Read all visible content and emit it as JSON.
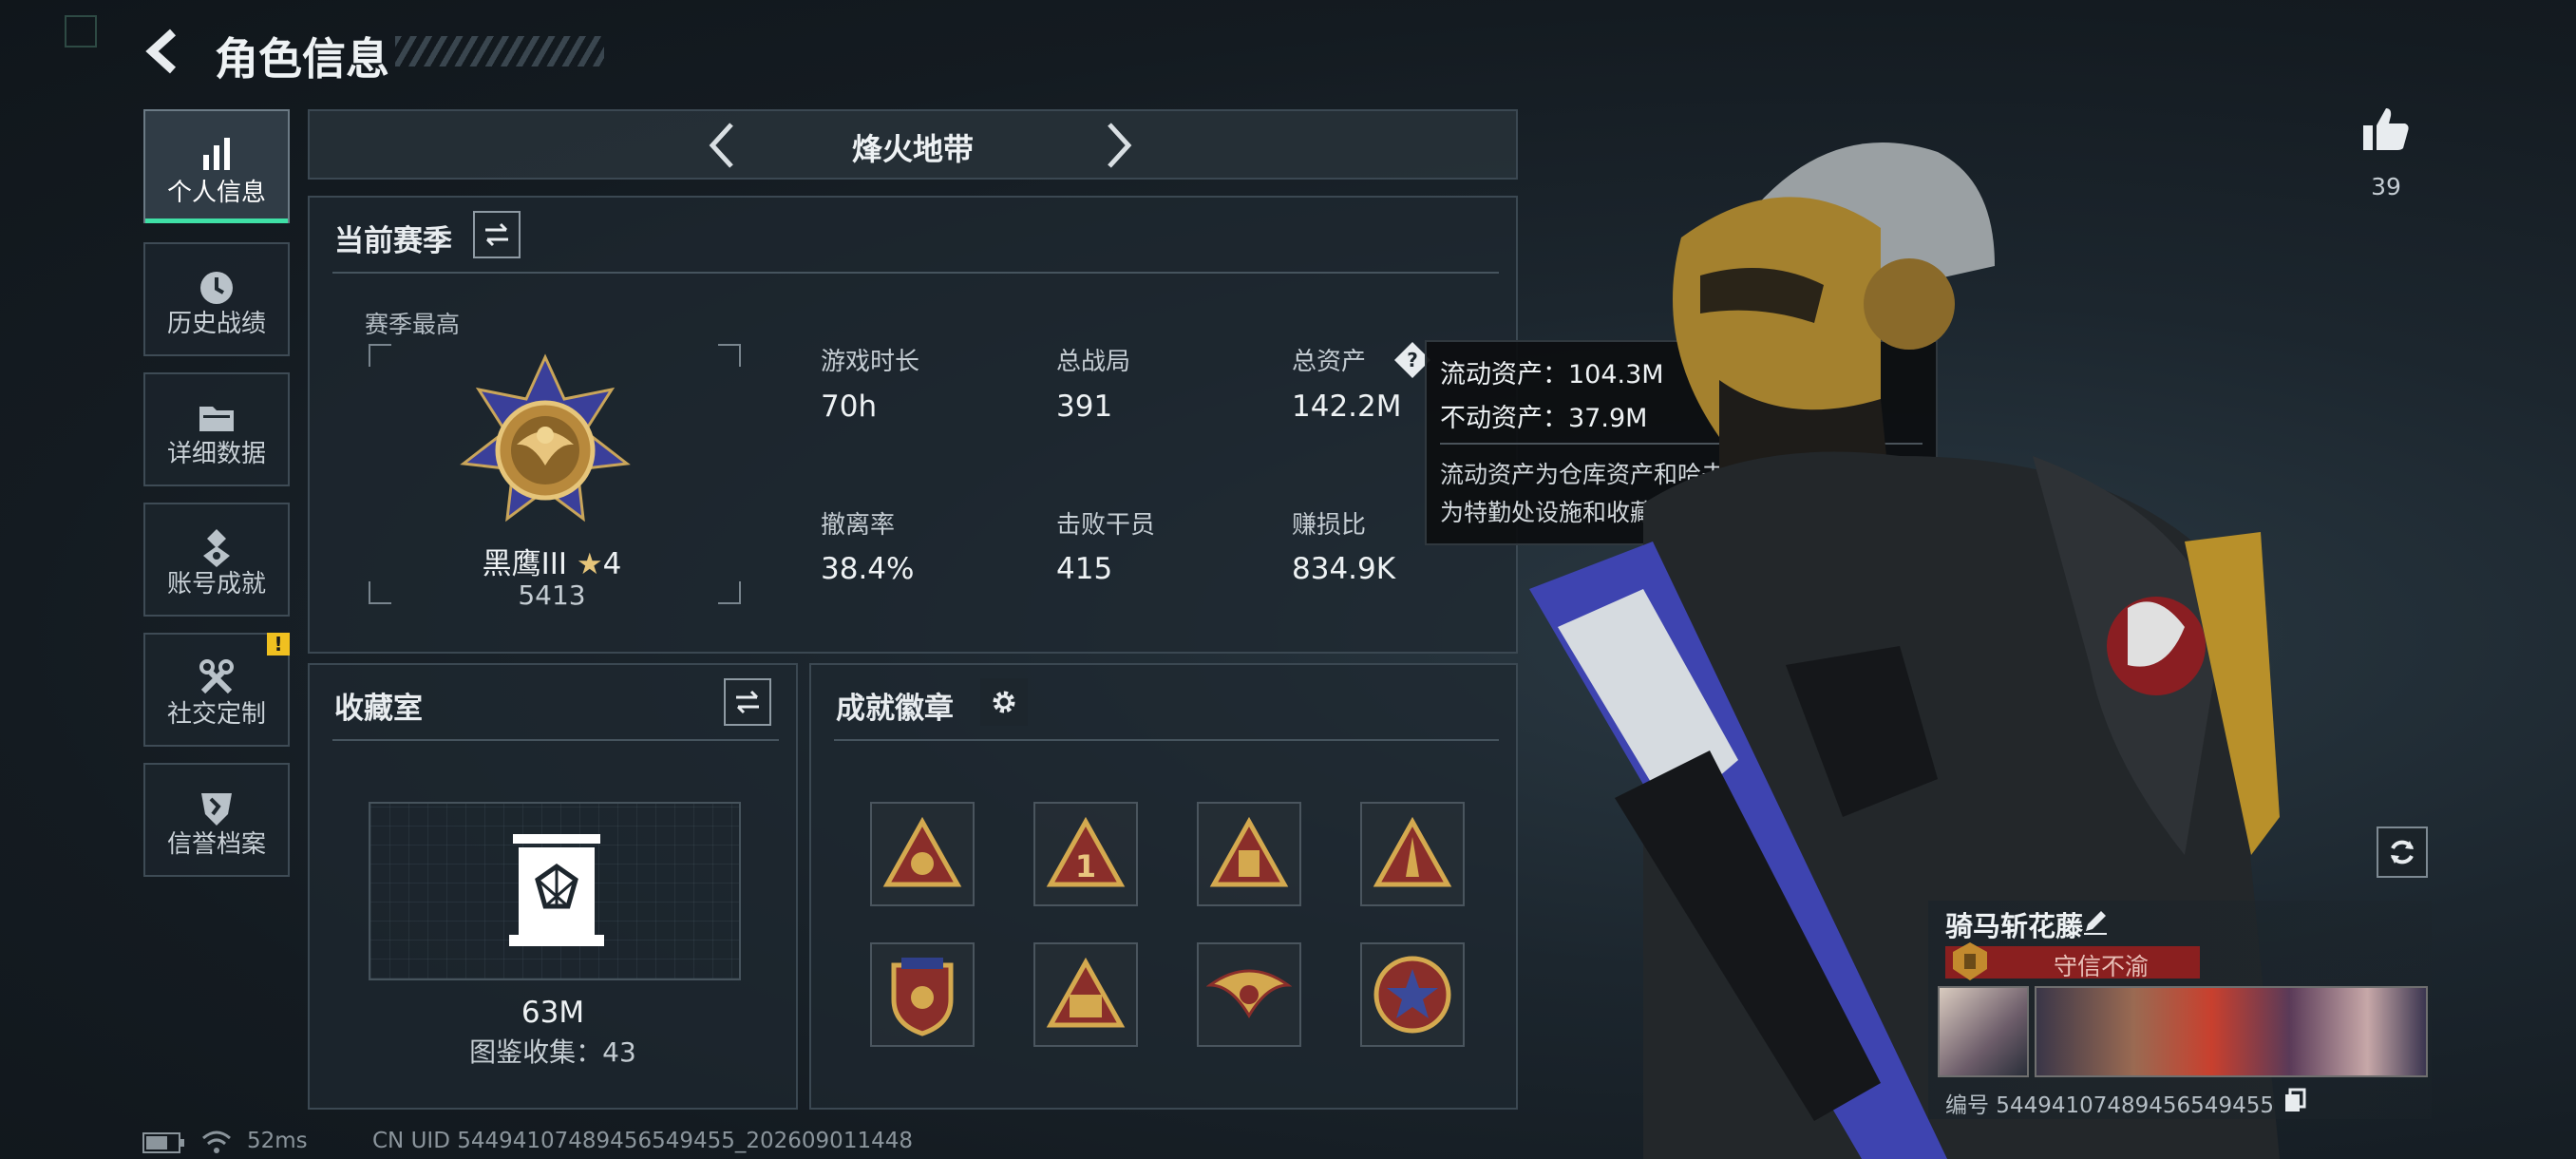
{
  "header": {
    "title": "角色信息"
  },
  "sidebar": {
    "items": [
      {
        "label": "个人信息",
        "icon": "bar-chart-icon",
        "active": true
      },
      {
        "label": "历史战绩",
        "icon": "history-clock-icon"
      },
      {
        "label": "详细数据",
        "icon": "folder-icon"
      },
      {
        "label": "账号成就",
        "icon": "medal-icon"
      },
      {
        "label": "社交定制",
        "icon": "wrench-icon",
        "alert": "!"
      },
      {
        "label": "信誉档案",
        "icon": "shield-icon"
      }
    ]
  },
  "mode_selector": {
    "label": "烽火地带"
  },
  "season": {
    "title": "当前赛季",
    "best_label": "赛季最高",
    "rank_name": "黑鹰III",
    "rank_stars": "4",
    "rank_points": "5413",
    "stats": [
      {
        "label": "游戏时长",
        "value": "70h"
      },
      {
        "label": "总战局",
        "value": "391"
      },
      {
        "label": "总资产",
        "value": "142.2M"
      },
      {
        "label": "撤离率",
        "value": "38.4%"
      },
      {
        "label": "击败干员",
        "value": "415"
      },
      {
        "label": "赚损比",
        "value": "834.9K"
      }
    ]
  },
  "tooltip": {
    "liquid": "流动资产：104.3M",
    "fixed": "不动资产：37.9M",
    "desc_line1": "流动资产为仓库资产和哈夫币，不动资产",
    "desc_line2": "为特勤处设施和收藏室设施"
  },
  "collection": {
    "title": "收藏室",
    "value": "63M",
    "count_label": "图鉴收集：43"
  },
  "achievements": {
    "title": "成就徽章",
    "badge_count": 8
  },
  "likes": {
    "count": "39"
  },
  "player": {
    "name": "骑马斩花藤",
    "title_badge": "守信不渝",
    "id_text": "编号 5449410748945654945​5"
  },
  "status_bar": {
    "ping": "52ms",
    "uid": "CN UID 5449410748945654945​5_202609011448"
  },
  "colors": {
    "accent_green": "#3fe0a6",
    "alert_yellow": "#f0c020",
    "title_red": "#8a1f1f"
  }
}
